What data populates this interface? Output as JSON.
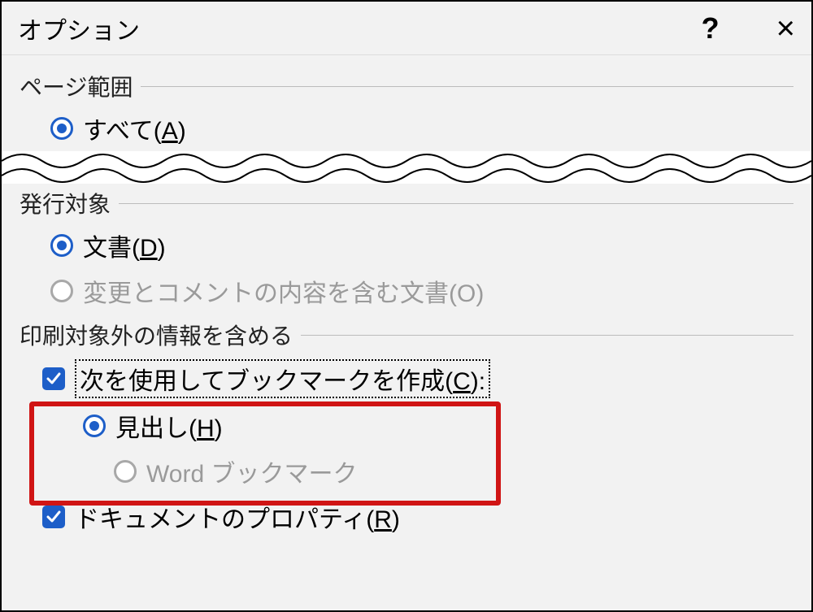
{
  "titlebar": {
    "title": "オプション",
    "help": "?",
    "close": "×"
  },
  "section_page_range": {
    "heading": "ページ範囲",
    "all": {
      "prefix": "すべて(",
      "accel": "A",
      "suffix": ")"
    }
  },
  "section_publish": {
    "heading": "発行対象",
    "document": {
      "prefix": "文書(",
      "accel": "D",
      "suffix": ")"
    },
    "markup": "変更とコメントの内容を含む文書(O)"
  },
  "section_nonprint": {
    "heading": "印刷対象外の情報を含める",
    "bookmarks": {
      "prefix": "次を使用してブックマークを作成(",
      "accel": "C",
      "suffix": "):"
    },
    "headings": {
      "prefix": "見出し(",
      "accel": "H",
      "suffix": ")"
    },
    "word_bookmarks": "Word ブックマーク",
    "doc_props": {
      "prefix": "ドキュメントのプロパティ(",
      "accel": "R",
      "suffix": ")"
    }
  }
}
